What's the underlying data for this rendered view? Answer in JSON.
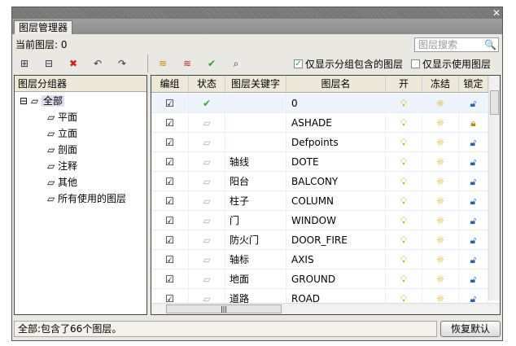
{
  "window": {
    "title": "图层管理器",
    "close": "✕"
  },
  "current_layer": "当前图层: 0",
  "search": {
    "placeholder": "图层搜索"
  },
  "filters": [
    {
      "label": "仅显示分组包含的图层",
      "checked": true
    },
    {
      "label": "仅显示使用图层",
      "checked": false
    }
  ],
  "left": {
    "header": "图层分组器",
    "root": "全部",
    "groups": [
      "平面",
      "立面",
      "剖面",
      "注释",
      "其他",
      "所有使用的图层"
    ]
  },
  "columns": [
    "编组",
    "状态",
    "图层关键字",
    "图层名",
    "开",
    "冻结",
    "锁定"
  ],
  "rows": [
    {
      "key": "",
      "name": "0",
      "current": true,
      "locked": false
    },
    {
      "key": "",
      "name": "ASHADE",
      "current": false,
      "locked": true
    },
    {
      "key": "",
      "name": "Defpoints",
      "current": false,
      "locked": false
    },
    {
      "key": "轴线",
      "name": "DOTE",
      "current": false,
      "locked": false
    },
    {
      "key": "阳台",
      "name": "BALCONY",
      "current": false,
      "locked": false
    },
    {
      "key": "柱子",
      "name": "COLUMN",
      "current": false,
      "locked": false
    },
    {
      "key": "门",
      "name": "WINDOW",
      "current": false,
      "locked": false
    },
    {
      "key": "防火门",
      "name": "DOOR_FIRE",
      "current": false,
      "locked": false
    },
    {
      "key": "轴标",
      "name": "AXIS",
      "current": false,
      "locked": false
    },
    {
      "key": "地面",
      "name": "GROUND",
      "current": false,
      "locked": false
    },
    {
      "key": "道路",
      "name": "ROAD",
      "current": false,
      "locked": false
    }
  ],
  "status": "全部:包含了66个图层。",
  "restore_button": "恢复默认",
  "colors": {
    "header": "#ece9d8",
    "accent": "#2a5db0"
  }
}
